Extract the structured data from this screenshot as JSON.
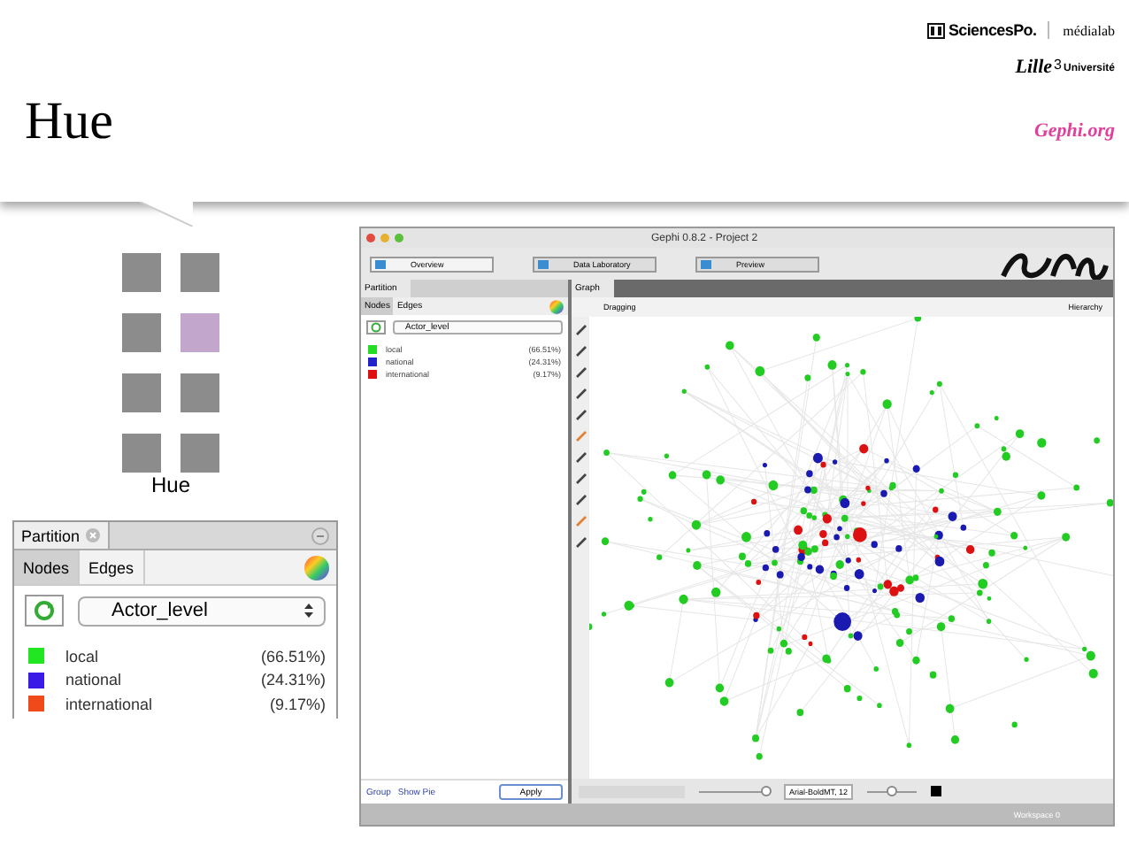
{
  "slide": {
    "title": "Hue"
  },
  "logos": {
    "sciences_po": "SciencesPo.",
    "medialab": "médialab",
    "lille": "Lille",
    "lille_number": "3",
    "universite": "Université",
    "gephi": "Gephi.org"
  },
  "hue_demo": {
    "label": "Hue",
    "swatches": [
      {
        "color": "#8c8c8c"
      },
      {
        "color": "#8c8c8c"
      },
      {
        "color": "#8c8c8c"
      },
      {
        "color": "#c2a6cc"
      },
      {
        "color": "#8c8c8c"
      },
      {
        "color": "#8c8c8c"
      },
      {
        "color": "#8c8c8c"
      },
      {
        "color": "#8c8c8c"
      }
    ]
  },
  "partition_zoom": {
    "tab": "Partition",
    "subtabs": [
      {
        "label": "Nodes",
        "selected": true
      },
      {
        "label": "Edges",
        "selected": false
      }
    ],
    "dropdown": "Actor_level",
    "items": [
      {
        "label": "local",
        "share": "(66.51%)",
        "color": "#22e622"
      },
      {
        "label": "national",
        "share": "(24.31%)",
        "color": "#3a1ae6"
      },
      {
        "label": "international",
        "share": "(9.17%)",
        "color": "#f04a1a"
      }
    ]
  },
  "gephi_window": {
    "title": "Gephi 0.8.2 - Project 2",
    "toolbar": [
      {
        "label": "Overview",
        "selected": true
      },
      {
        "label": "Data Laboratory",
        "selected": false
      },
      {
        "label": "Preview",
        "selected": false
      }
    ],
    "partition": {
      "tab": "Partition",
      "subtabs": [
        {
          "label": "Nodes",
          "selected": true
        },
        {
          "label": "Edges",
          "selected": false
        }
      ],
      "dropdown": "Actor_level",
      "items": [
        {
          "label": "local",
          "share": "(66.51%)",
          "color": "#22dd22"
        },
        {
          "label": "national",
          "share": "(24.31%)",
          "color": "#2222cc"
        },
        {
          "label": "international",
          "share": "(9.17%)",
          "color": "#dd1111"
        }
      ],
      "links": [
        "Group",
        "Show Pie"
      ],
      "apply": "Apply"
    },
    "graph": {
      "tab": "Graph",
      "mode": "Dragging",
      "hierarchy": "Hierarchy",
      "font_field": "Arial-BoldMT, 12",
      "edge_slider": {
        "level": 0.95
      },
      "label_slider": {
        "level": 0.5
      },
      "workspace": "Workspace 0"
    }
  }
}
